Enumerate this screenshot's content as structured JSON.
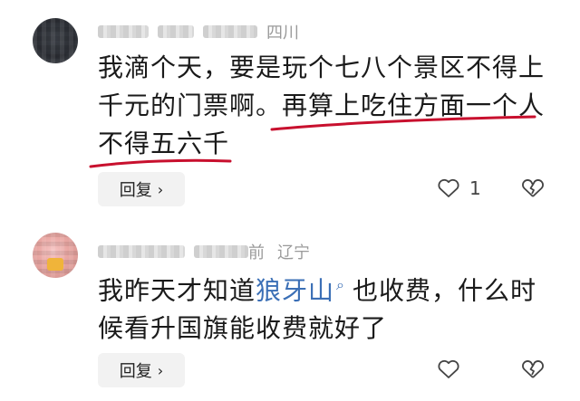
{
  "comments": [
    {
      "location": "四川",
      "text_plain": "我滴个天，要是玩个七八个景区不得上千元的门票啊。",
      "text_underlined_1": "再算上吃住方面一个人",
      "text_underlined_2": "不得五六千",
      "reply_label": "回复",
      "like_count": "1"
    },
    {
      "time_suffix": "前",
      "location": "辽宁",
      "text_before_link": "我昨天才知道",
      "link_text": "狼牙山",
      "text_after_link": "也收费，什么时候看升国旗能收费就好了",
      "reply_label": "回复"
    }
  ],
  "icons": {
    "like": "thumbs-up-icon",
    "dislike": "thumbs-down-icon",
    "reply_chevron": "chevron-right-icon",
    "link_search": "search-icon"
  },
  "colors": {
    "link": "#3b6fb6",
    "underline": "#c8102e",
    "meta": "#9a9a9a"
  }
}
